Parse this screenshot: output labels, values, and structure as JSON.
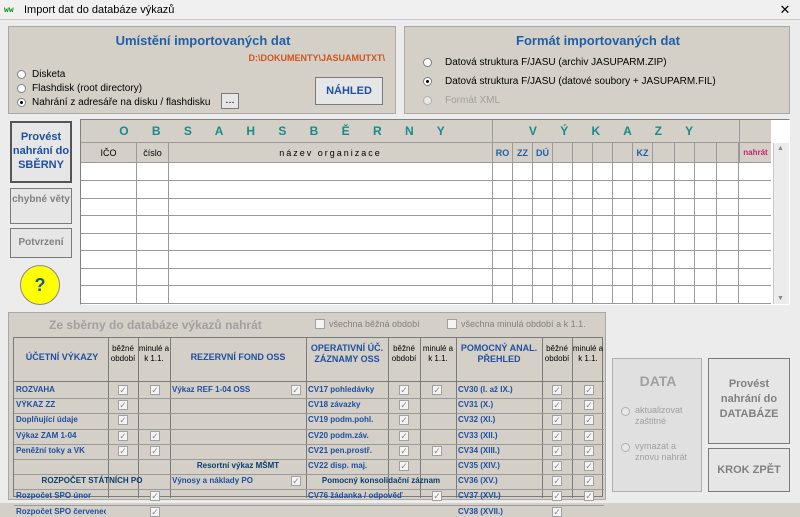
{
  "window": {
    "title": "Import dat do databáze výkazů",
    "close": "✕",
    "icon": "ww"
  },
  "location": {
    "title": "Umístění importovaných dat",
    "path": "D:\\DOKUMENTY\\JASUAMUTXT\\",
    "options": [
      "Disketa",
      "Flashdisk (root directory)",
      "Nahrání z adresáře na disku / flashdisku"
    ],
    "selected": 2,
    "browse": "...",
    "preview": "NÁHLED"
  },
  "format": {
    "title": "Formát importovaných dat",
    "options": [
      "Datová struktura F/JASU (archiv JASUPARM.ZIP)",
      "Datová struktura F/JASU (datové soubory + JASUPARM.FIL)",
      "Formát XML"
    ],
    "selected": 1
  },
  "side_buttons": {
    "upload": "Provést nahrání do SBĚRNY",
    "errors": "chybné věty",
    "confirm": "Potvrzení",
    "help": "?"
  },
  "collection": {
    "title": "O B S A H   S B Ě R N Y",
    "reports_title": "V Ý K A Z Y",
    "columns": [
      "IČO",
      "číslo",
      "název organizace"
    ],
    "report_cols": [
      "RO",
      "ZZ",
      "DÚ",
      "",
      "",
      "",
      "",
      "KZ",
      "",
      "",
      "",
      ""
    ],
    "upload_col": "nahrát"
  },
  "bottom": {
    "title": "Ze  sběrny do databáze výkazů nahrát",
    "all_current": "všechna běžná období",
    "all_past": "všechna minulá období a k 1.1.",
    "col1": {
      "header": "ÚČETNÍ VÝKAZY",
      "current": "běžné období",
      "past": "minulé a k 1.1.",
      "rows": [
        "ROZVAHA",
        "VÝKAZ  ZZ",
        "Doplňující údaje",
        "Výkaz  ZAM 1-04",
        "Peněžní toky a VK"
      ]
    },
    "col1b": {
      "header": "ROZPOČET STÁTNÍCH PO",
      "rows": [
        "Rozpočet SPO únor",
        "Rozpočet SPO červenec"
      ]
    },
    "col2": {
      "header": "REZERVNÍ FOND OSS",
      "rows": [
        "Výkaz  REF 1-04  OSS"
      ]
    },
    "col2b": {
      "header": "Resortní výkaz MŠMT",
      "rows": [
        "Výnosy a náklady PO"
      ]
    },
    "col3": {
      "header": "OPERATIVNÍ ÚČ. ZÁZNAMY OSS",
      "current": "běžné období",
      "past": "minulé a k 1.1.",
      "rows": [
        "CV17 pohledávky",
        "CV18 závazky",
        "CV19 podm.pohl.",
        "CV20 podm.záv.",
        "CV21 pen.prostř.",
        "CV22 disp. maj."
      ]
    },
    "col3b": {
      "header": "Pomocný konsolidační záznam",
      "rows": [
        "CV76  žádanka / odpověď"
      ]
    },
    "col4": {
      "header": "POMOCNÝ ANAL. PŘEHLED",
      "current": "běžné období",
      "past": "minulé a k 1.1.",
      "rows": [
        "CV30 (I. až IX.)",
        "CV31 (X.)",
        "CV32 (XI.)",
        "CV33 (XII.)",
        "CV34 (XIII.)",
        "CV35 (XIV.)",
        "CV36 (XV.)",
        "CV37 (XVI.)",
        "CV38 (XVII.)"
      ]
    }
  },
  "data_box": {
    "title": "DATA",
    "options": [
      "aktualizovat zaštitné",
      "vymazat a znovu nahrát"
    ]
  },
  "db_button": "Provést nahrání do DATABÁZE",
  "back_button": "KROK ZPĚT",
  "colors": {
    "accent_blue": "#1e5fa8",
    "path_red": "#d0541c",
    "teal": "#1a8a8a",
    "help_yellow": "#ffff00"
  }
}
